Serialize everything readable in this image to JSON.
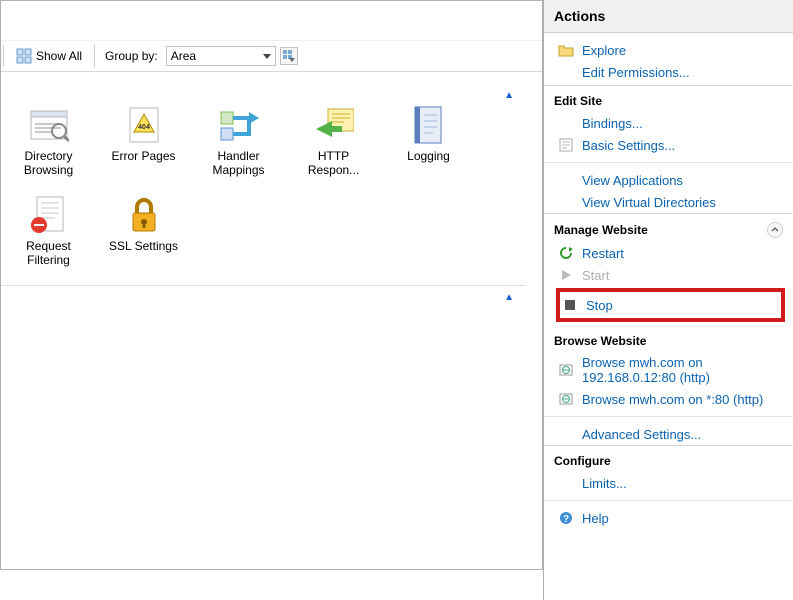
{
  "toolbar": {
    "show_all": "Show All",
    "group_by_label": "Group by:",
    "group_by_value": "Area"
  },
  "features_row1": [
    {
      "name": "directory-browsing",
      "label": "Directory Browsing"
    },
    {
      "name": "error-pages",
      "label": "Error Pages"
    },
    {
      "name": "handler-mappings",
      "label": "Handler Mappings"
    },
    {
      "name": "http-response",
      "label": "HTTP Respon..."
    },
    {
      "name": "logging",
      "label": "Logging"
    }
  ],
  "features_row2": [
    {
      "name": "request-filtering",
      "label": "Request Filtering"
    },
    {
      "name": "ssl-settings",
      "label": "SSL Settings"
    }
  ],
  "actions": {
    "title": "Actions",
    "explore": "Explore",
    "edit_permissions": "Edit Permissions...",
    "edit_site": "Edit Site",
    "bindings": "Bindings...",
    "basic_settings": "Basic Settings...",
    "view_applications": "View Applications",
    "view_virtual_dirs": "View Virtual Directories",
    "manage_website": "Manage Website",
    "restart": "Restart",
    "start": "Start",
    "stop": "Stop",
    "browse_website": "Browse Website",
    "browse1": "Browse mwh.com on 192.168.0.12:80 (http)",
    "browse2": "Browse mwh.com on *:80 (http)",
    "advanced_settings": "Advanced Settings...",
    "configure": "Configure",
    "limits": "Limits...",
    "help": "Help"
  }
}
